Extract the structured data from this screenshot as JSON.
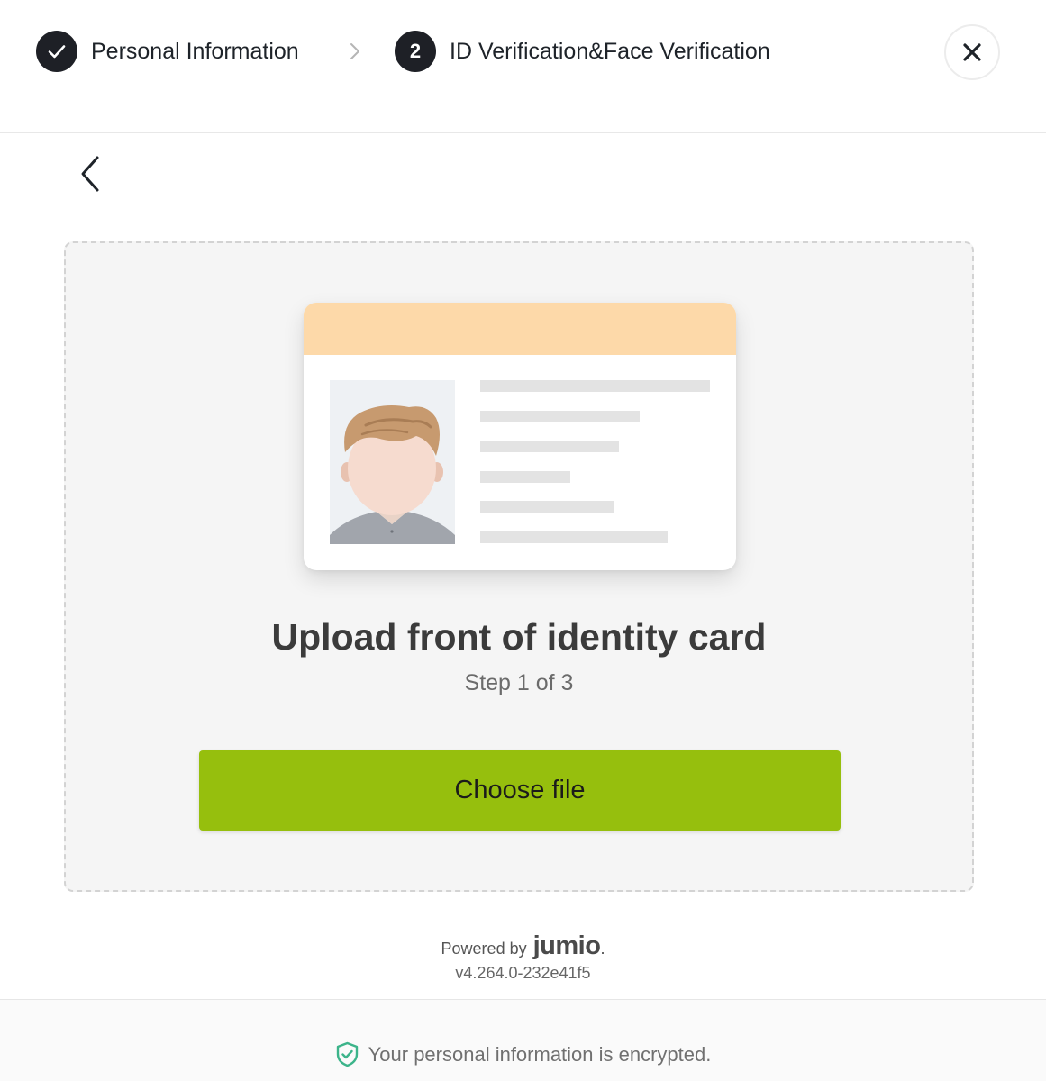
{
  "steps": [
    {
      "label": "Personal Information",
      "status": "completed",
      "icon": "check-icon"
    },
    {
      "label": "ID Verification&Face Verification",
      "status": "active",
      "number": "2"
    }
  ],
  "step_separator_icon": "chevron-right-icon",
  "close_icon": "close-icon",
  "back_icon": "chevron-left-icon",
  "upload": {
    "illustration": "id-card-illustration",
    "title": "Upload front of identity card",
    "step_text": "Step 1 of 3",
    "button_label": "Choose file"
  },
  "branding": {
    "powered_by": "Powered by",
    "logo_text": "jumio",
    "version": "v4.264.0-232e41f5"
  },
  "footer": {
    "icon": "shield-check-icon",
    "text": "Your personal information is encrypted."
  },
  "colors": {
    "accent": "#96bf0d",
    "step_circle": "#1e2026",
    "card_header": "#fdd9a9",
    "shield": "#3cb48a"
  }
}
